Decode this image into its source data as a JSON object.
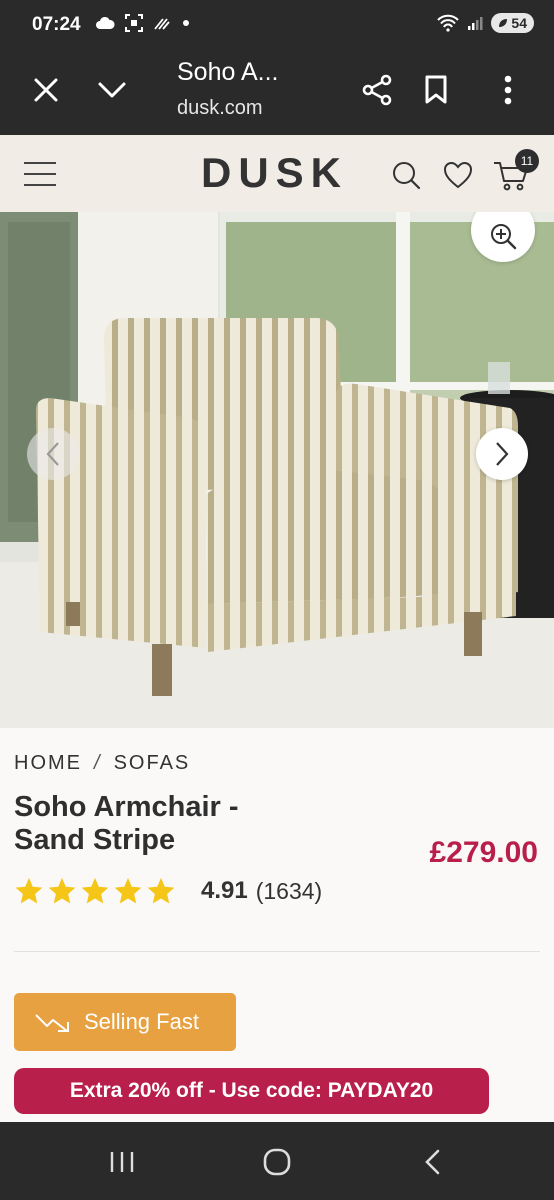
{
  "status_bar": {
    "time": "07:24",
    "battery": "54",
    "icons": [
      "cloud-icon",
      "screenshot-icon",
      "no-signal-icon",
      "dot-icon",
      "wifi-icon",
      "signal-icon",
      "battery-icon"
    ]
  },
  "browser": {
    "title": "Soho A...",
    "url": "dusk.com",
    "icons": [
      "close-icon",
      "chevron-down-icon",
      "share-icon",
      "bookmark-icon",
      "more-vert-icon"
    ]
  },
  "site_header": {
    "logo": "DUSK",
    "cart_count": "11",
    "icons": [
      "menu-icon",
      "search-icon",
      "heart-icon",
      "cart-icon"
    ]
  },
  "product": {
    "breadcrumb": [
      "HOME",
      "SOFAS"
    ],
    "breadcrumb_separator": "/",
    "title_line1": "Soho Armchair -",
    "title_line2": "Sand Stripe",
    "price": "£279.00",
    "rating_value": "4.91",
    "rating_count": "(1634)",
    "stars": 5,
    "selling_fast_label": "Selling Fast",
    "promo_text": "Extra 20% off - Use code: PAYDAY20"
  },
  "colors": {
    "accent_price": "#b81f4b",
    "selling_fast": "#e8a140",
    "star": "#f5c518",
    "header_bg": "#f1ece6",
    "system_bar": "#2a2a2a"
  },
  "nav_bar": {
    "icons": [
      "recent-apps-icon",
      "home-icon",
      "back-icon"
    ]
  }
}
